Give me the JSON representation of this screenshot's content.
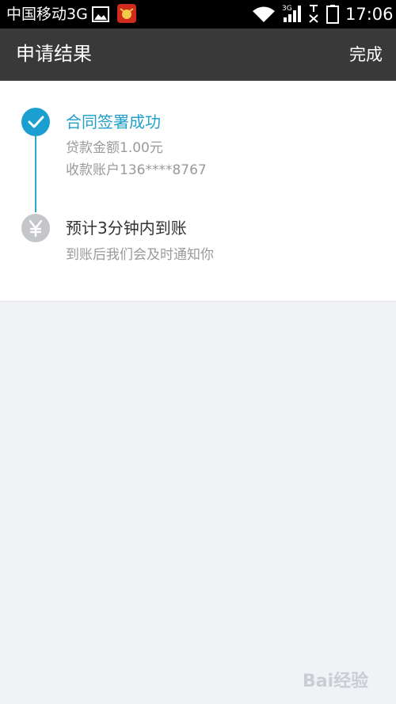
{
  "status_bar": {
    "carrier": "中国移动3G",
    "network_label": "3G",
    "time": "17:06",
    "icons": [
      "gallery-icon",
      "app-icon",
      "wifi-icon",
      "signal-icon",
      "no-sim-icon",
      "battery-icon"
    ]
  },
  "app_bar": {
    "title": "申请结果",
    "done_label": "完成"
  },
  "steps": [
    {
      "title": "合同签署成功",
      "lines": [
        "贷款金额1.00元",
        "收款账户136****8767"
      ],
      "icon": "check-icon",
      "status": "done"
    },
    {
      "title": "预计3分钟内到账",
      "lines": [
        "到账后我们会及时通知你"
      ],
      "icon": "yuan-icon",
      "status": "pending"
    }
  ],
  "watermark": "Bai经验",
  "colors": {
    "accent": "#1f9fca",
    "app_bar": "#393939",
    "status_bar": "#000000",
    "pending_icon": "#c4c6ca",
    "page_bg": "#f0f2f5"
  }
}
